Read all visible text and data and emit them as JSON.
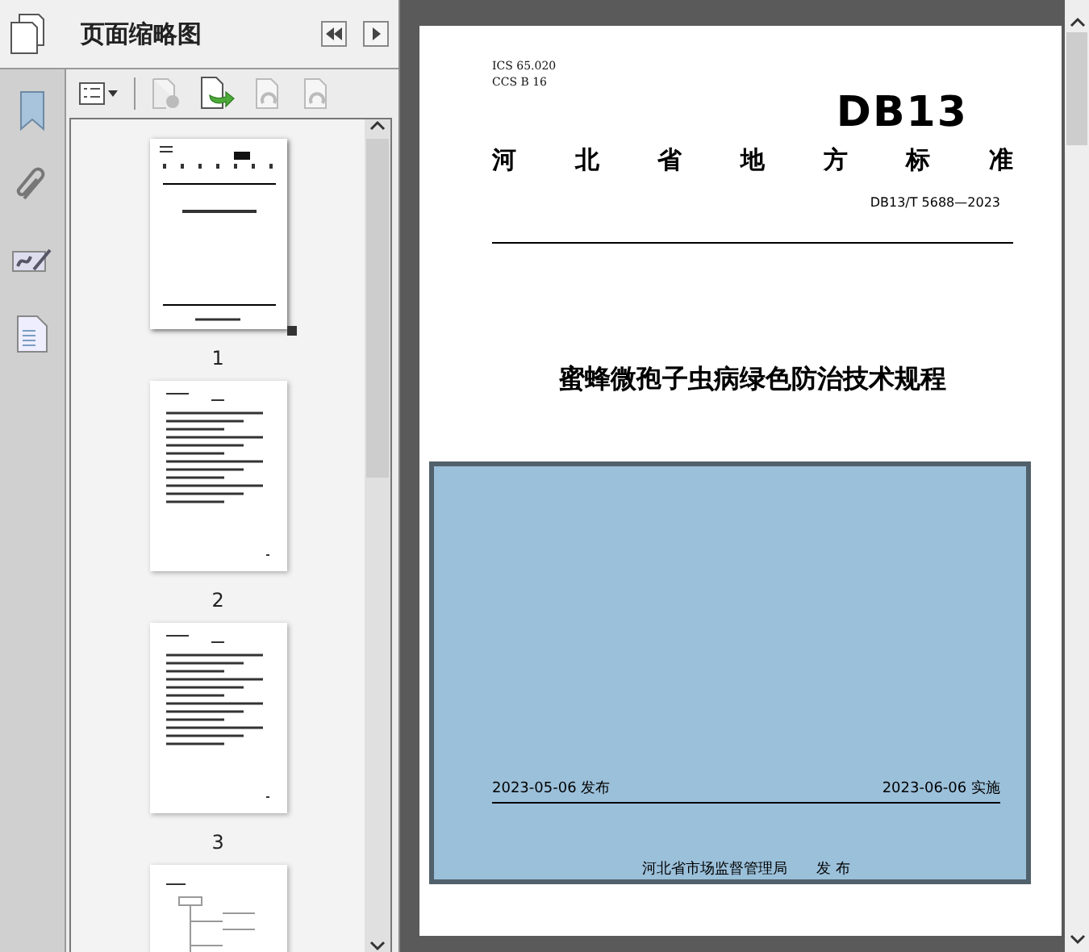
{
  "panel": {
    "title": "页面缩略图"
  },
  "rail": [
    {
      "kind": "bookmark",
      "selected": false
    },
    {
      "kind": "attachment",
      "selected": false
    },
    {
      "kind": "signature",
      "selected": false
    },
    {
      "kind": "layers",
      "selected": false
    }
  ],
  "toolbar": [
    {
      "kind": "options",
      "disabled": false
    },
    {
      "kind": "delete",
      "disabled": true
    },
    {
      "kind": "insert",
      "disabled": false
    },
    {
      "kind": "undo",
      "disabled": true
    },
    {
      "kind": "redo",
      "disabled": true
    }
  ],
  "thumbnails": [
    {
      "label": "1",
      "kind": "cover",
      "selected": true
    },
    {
      "label": "2",
      "kind": "text",
      "selected": false
    },
    {
      "label": "3",
      "kind": "text",
      "selected": false
    },
    {
      "kind": "diagram",
      "selected": false
    }
  ],
  "document": {
    "ics": "ICS  65.020",
    "ccs": "CCS  B 16",
    "logo": "DB13",
    "category": [
      "河",
      "北",
      "省",
      "地",
      "方",
      "标",
      "准"
    ],
    "number": "DB13/T 5688—2023",
    "title": "蜜蜂微孢子虫病绿色防治技术规程",
    "issue_date": "2023-05-06 发布",
    "effective_date": "2023-06-06 实施",
    "issuer": "河北省市场监督管理局",
    "issuer_action": "发  布"
  }
}
